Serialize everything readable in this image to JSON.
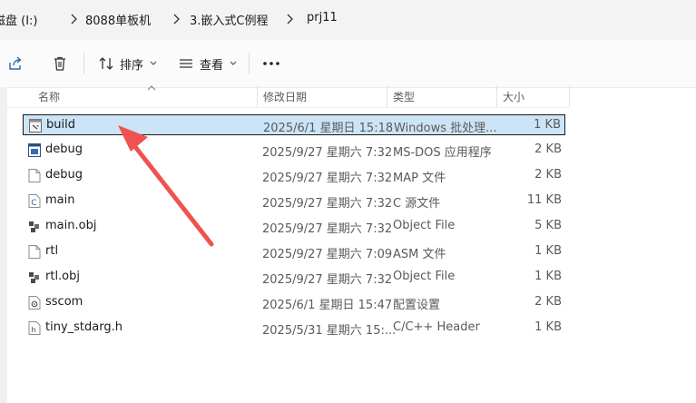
{
  "breadcrumb": [
    "磁盘 (I:)",
    "8088单板机",
    "3.嵌入式C例程",
    "prj11"
  ],
  "toolbar": {
    "sort_label": "排序",
    "view_label": "查看"
  },
  "columns": {
    "name": "名称",
    "date": "修改日期",
    "type": "类型",
    "size": "大小"
  },
  "files": [
    {
      "name": "build",
      "date": "2025/6/1 星期日 15:18",
      "type": "Windows 批处理...",
      "size": "1 KB",
      "icon": "batch-file-icon",
      "selected": true
    },
    {
      "name": "debug",
      "date": "2025/9/27 星期六 7:32",
      "type": "MS-DOS 应用程序",
      "size": "2 KB",
      "icon": "exe-file-icon"
    },
    {
      "name": "debug",
      "date": "2025/9/27 星期六 7:32",
      "type": "MAP 文件",
      "size": "2 KB",
      "icon": "generic-file-icon"
    },
    {
      "name": "main",
      "date": "2025/9/27 星期六 7:32",
      "type": "C 源文件",
      "size": "11 KB",
      "icon": "c-source-file-icon"
    },
    {
      "name": "main.obj",
      "date": "2025/9/27 星期六 7:32",
      "type": "Object File",
      "size": "5 KB",
      "icon": "object-file-icon"
    },
    {
      "name": "rtl",
      "date": "2025/9/27 星期六 7:09",
      "type": "ASM 文件",
      "size": "1 KB",
      "icon": "generic-file-icon"
    },
    {
      "name": "rtl.obj",
      "date": "2025/9/27 星期六 7:32",
      "type": "Object File",
      "size": "1 KB",
      "icon": "object-file-icon"
    },
    {
      "name": "sscom",
      "date": "2025/6/1 星期日 15:47",
      "type": "配置设置",
      "size": "2 KB",
      "icon": "settings-file-icon"
    },
    {
      "name": "tiny_stdarg.h",
      "date": "2025/5/31 星期六 15:...",
      "type": "C/C++ Header",
      "size": "1 KB",
      "icon": "header-file-icon"
    }
  ],
  "colors": {
    "selection_fill": "#cce4f7",
    "annotation_arrow": "#ef5350"
  }
}
